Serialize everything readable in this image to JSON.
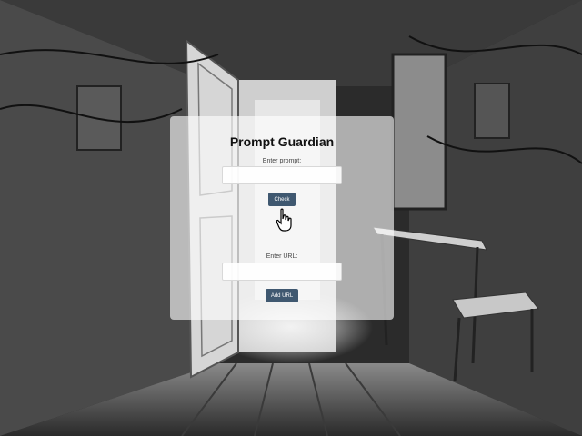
{
  "app": {
    "title": "Prompt Guardian"
  },
  "prompt_form": {
    "label": "Enter prompt:",
    "value": "",
    "placeholder": "",
    "check_label": "Check"
  },
  "url_form": {
    "label": "Enter URL:",
    "value": "",
    "placeholder": "",
    "add_label": "Add URL"
  },
  "colors": {
    "button": "#3f5870",
    "panel": "rgba(255,255,255,0.62)"
  },
  "icons": {
    "cursor": "hand-pointer-icon"
  }
}
